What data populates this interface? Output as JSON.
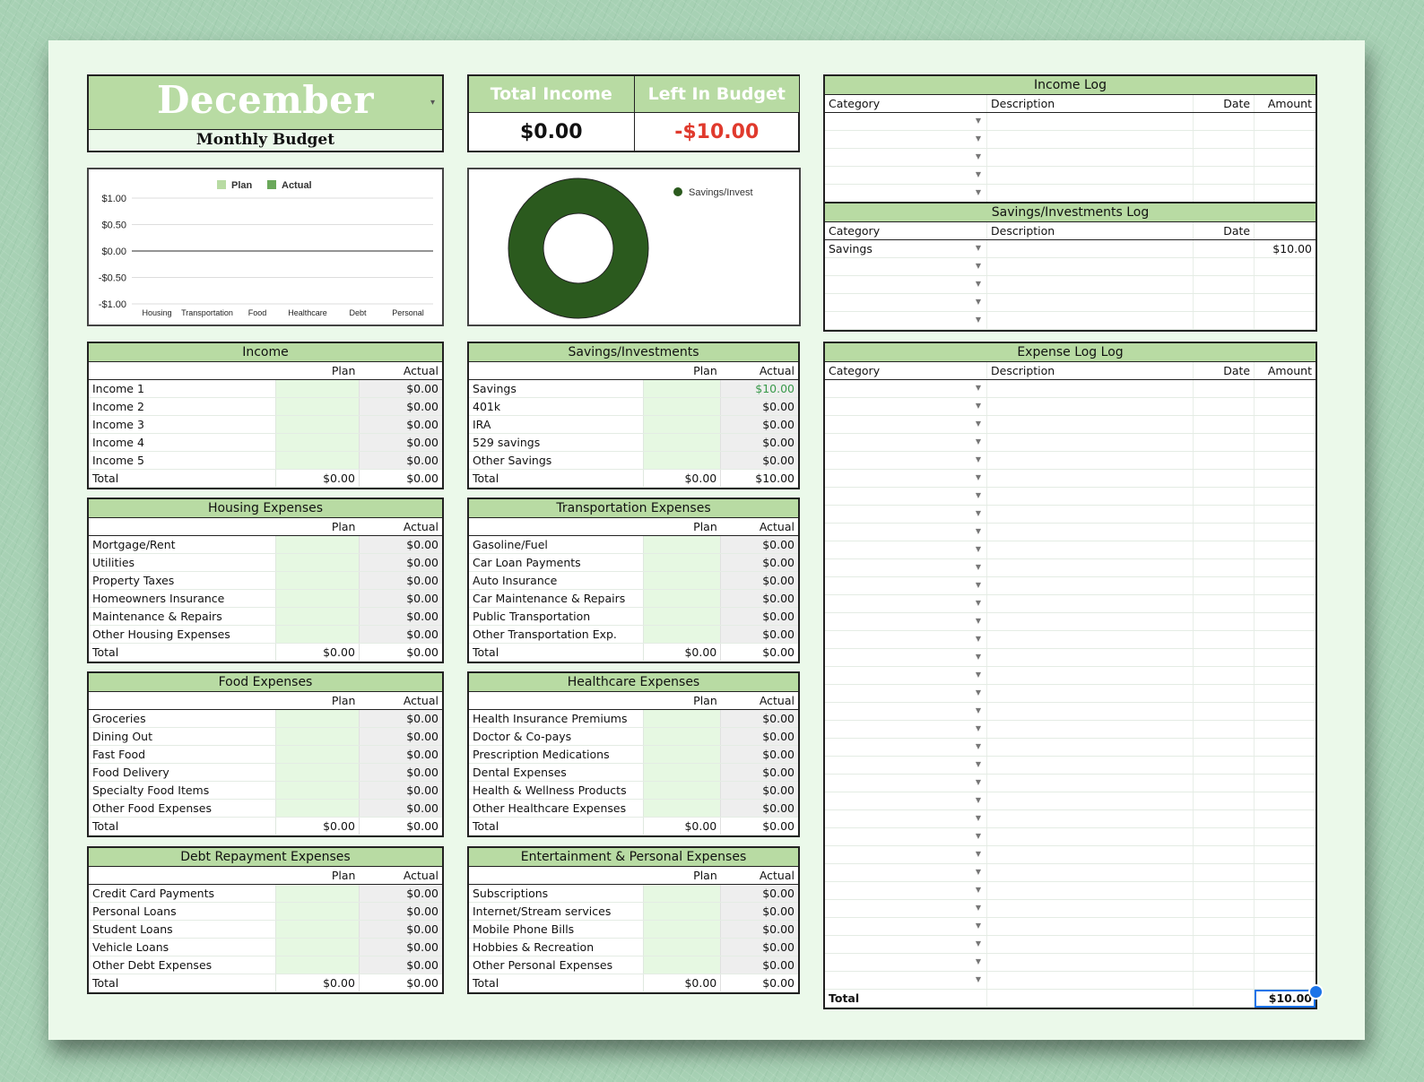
{
  "title": {
    "month": "December",
    "subtitle": "Monthly Budget"
  },
  "summary": {
    "total_income_label": "Total Income",
    "total_income_value": "$0.00",
    "left_label": "Left In Budget",
    "left_value": "-$10.00",
    "left_color": "#e03a2d"
  },
  "bar_chart": {
    "legend_plan": "Plan",
    "legend_actual": "Actual",
    "plan_color": "#b8dba3",
    "actual_color": "#6aa85a"
  },
  "donut_chart": {
    "legend": "Savings/Invest",
    "color": "#2b5a1e"
  },
  "chart_data": [
    {
      "type": "bar",
      "categories": [
        "Housing",
        "Transportation",
        "Food",
        "Healthcare",
        "Debt",
        "Personal"
      ],
      "series": [
        {
          "name": "Plan",
          "values": [
            0,
            0,
            0,
            0,
            0,
            0
          ]
        },
        {
          "name": "Actual",
          "values": [
            0,
            0,
            0,
            0,
            0,
            0
          ]
        }
      ],
      "ylim": [
        -1,
        1
      ],
      "yticks": [
        "$1.00",
        "$0.50",
        "$0.00",
        "-$0.50",
        "-$1.00"
      ],
      "legend": "top"
    },
    {
      "type": "pie",
      "categories": [
        "Savings/Invest"
      ],
      "values": [
        10
      ],
      "legend": "top-right"
    }
  ],
  "col_plan": "Plan",
  "col_actual": "Actual",
  "total_label": "Total",
  "income": {
    "title": "Income",
    "rows": [
      {
        "label": "Income 1",
        "actual": "$0.00"
      },
      {
        "label": "Income 2",
        "actual": "$0.00"
      },
      {
        "label": "Income 3",
        "actual": "$0.00"
      },
      {
        "label": "Income 4",
        "actual": "$0.00"
      },
      {
        "label": "Income 5",
        "actual": "$0.00"
      }
    ],
    "total_plan": "$0.00",
    "total_actual": "$0.00"
  },
  "savings": {
    "title": "Savings/Investments",
    "rows": [
      {
        "label": "Savings",
        "actual": "$10.00"
      },
      {
        "label": "401k",
        "actual": "$0.00"
      },
      {
        "label": "IRA",
        "actual": "$0.00"
      },
      {
        "label": "529 savings",
        "actual": "$0.00"
      },
      {
        "label": "Other Savings",
        "actual": "$0.00"
      }
    ],
    "total_plan": "$0.00",
    "total_actual": "$10.00"
  },
  "housing": {
    "title": "Housing Expenses",
    "rows": [
      {
        "label": "Mortgage/Rent",
        "actual": "$0.00"
      },
      {
        "label": "Utilities",
        "actual": "$0.00"
      },
      {
        "label": "Property Taxes",
        "actual": "$0.00"
      },
      {
        "label": "Homeowners Insurance",
        "actual": "$0.00"
      },
      {
        "label": "Maintenance & Repairs",
        "actual": "$0.00"
      },
      {
        "label": "Other Housing Expenses",
        "actual": "$0.00"
      }
    ],
    "total_plan": "$0.00",
    "total_actual": "$0.00"
  },
  "transportation": {
    "title": "Transportation Expenses",
    "rows": [
      {
        "label": "Gasoline/Fuel",
        "actual": "$0.00"
      },
      {
        "label": "Car Loan Payments",
        "actual": "$0.00"
      },
      {
        "label": "Auto Insurance",
        "actual": "$0.00"
      },
      {
        "label": "Car Maintenance & Repairs",
        "actual": "$0.00"
      },
      {
        "label": "Public Transportation",
        "actual": "$0.00"
      },
      {
        "label": "Other Transportation Exp.",
        "actual": "$0.00"
      }
    ],
    "total_plan": "$0.00",
    "total_actual": "$0.00"
  },
  "food": {
    "title": "Food Expenses",
    "rows": [
      {
        "label": "Groceries",
        "actual": "$0.00"
      },
      {
        "label": "Dining Out",
        "actual": "$0.00"
      },
      {
        "label": "Fast Food",
        "actual": "$0.00"
      },
      {
        "label": "Food Delivery",
        "actual": "$0.00"
      },
      {
        "label": "Specialty Food Items",
        "actual": "$0.00"
      },
      {
        "label": "Other Food Expenses",
        "actual": "$0.00"
      }
    ],
    "total_plan": "$0.00",
    "total_actual": "$0.00"
  },
  "healthcare": {
    "title": "Healthcare Expenses",
    "rows": [
      {
        "label": "Health Insurance Premiums",
        "actual": "$0.00"
      },
      {
        "label": "Doctor & Co-pays",
        "actual": "$0.00"
      },
      {
        "label": "Prescription Medications",
        "actual": "$0.00"
      },
      {
        "label": "Dental Expenses",
        "actual": "$0.00"
      },
      {
        "label": "Health & Wellness Products",
        "actual": "$0.00"
      },
      {
        "label": "Other Healthcare Expenses",
        "actual": "$0.00"
      }
    ],
    "total_plan": "$0.00",
    "total_actual": "$0.00"
  },
  "debt": {
    "title": "Debt Repayment Expenses",
    "rows": [
      {
        "label": "Credit Card Payments",
        "actual": "$0.00"
      },
      {
        "label": "Personal Loans",
        "actual": "$0.00"
      },
      {
        "label": "Student Loans",
        "actual": "$0.00"
      },
      {
        "label": "Vehicle Loans",
        "actual": "$0.00"
      },
      {
        "label": "Other Debt Expenses",
        "actual": "$0.00"
      }
    ],
    "total_plan": "$0.00",
    "total_actual": "$0.00"
  },
  "entertainment": {
    "title": "Entertainment & Personal Expenses",
    "rows": [
      {
        "label": "Subscriptions",
        "actual": "$0.00"
      },
      {
        "label": "Internet/Stream services",
        "actual": "$0.00"
      },
      {
        "label": "Mobile Phone Bills",
        "actual": "$0.00"
      },
      {
        "label": "Hobbies & Recreation",
        "actual": "$0.00"
      },
      {
        "label": "Other Personal Expenses",
        "actual": "$0.00"
      }
    ],
    "total_plan": "$0.00",
    "total_actual": "$0.00"
  },
  "income_log": {
    "title": "Income Log",
    "headers": [
      "Category",
      "Description",
      "Date",
      "Amount"
    ],
    "rows": [
      {
        "category": "",
        "description": "",
        "date": "",
        "amount": ""
      },
      {
        "category": "",
        "description": "",
        "date": "",
        "amount": ""
      },
      {
        "category": "",
        "description": "",
        "date": "",
        "amount": ""
      },
      {
        "category": "",
        "description": "",
        "date": "",
        "amount": ""
      },
      {
        "category": "",
        "description": "",
        "date": "",
        "amount": ""
      }
    ]
  },
  "savings_log": {
    "title": "Savings/Investments Log",
    "headers": [
      "Category",
      "Description",
      "Date",
      ""
    ],
    "rows": [
      {
        "category": "Savings",
        "description": "",
        "date": "",
        "amount": "$10.00"
      },
      {
        "category": "",
        "description": "",
        "date": "",
        "amount": ""
      },
      {
        "category": "",
        "description": "",
        "date": "",
        "amount": ""
      },
      {
        "category": "",
        "description": "",
        "date": "",
        "amount": ""
      },
      {
        "category": "",
        "description": "",
        "date": "",
        "amount": ""
      }
    ]
  },
  "expense_log": {
    "title": "Expense Log Log",
    "headers": [
      "Category",
      "Description",
      "Date",
      "Amount"
    ],
    "empty_rows": 34,
    "total_label": "Total",
    "total_value": "$10.00"
  }
}
